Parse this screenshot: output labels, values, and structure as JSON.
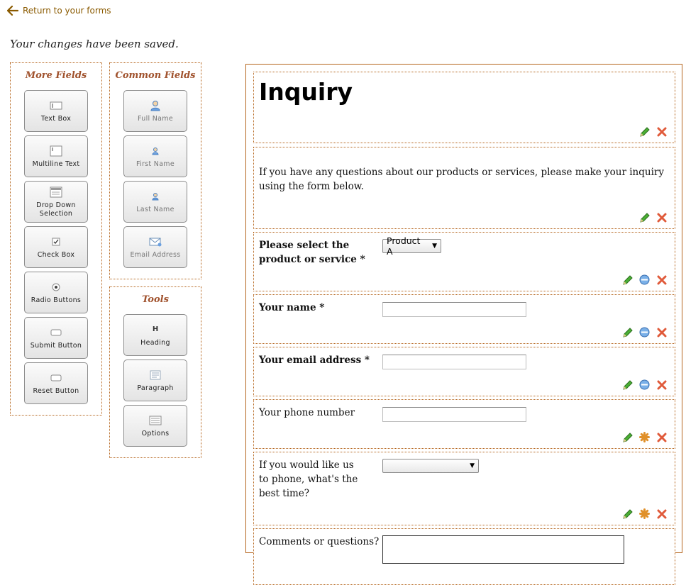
{
  "nav": {
    "return_label": "Return to your forms"
  },
  "status": {
    "saved_message": "Your changes have been saved."
  },
  "more_fields": {
    "title": "More Fields",
    "items": [
      {
        "label": "Text Box",
        "icon": "text-box-icon"
      },
      {
        "label": "Multiline Text",
        "icon": "multiline-text-icon"
      },
      {
        "label": "Drop Down Selection",
        "icon": "dropdown-icon"
      },
      {
        "label": "Check Box",
        "icon": "checkbox-icon"
      },
      {
        "label": "Radio Buttons",
        "icon": "radio-icon"
      },
      {
        "label": "Submit Button",
        "icon": "button-icon"
      },
      {
        "label": "Reset Button",
        "icon": "button-icon"
      }
    ]
  },
  "common_fields": {
    "title": "Common Fields",
    "items": [
      {
        "label": "Full Name",
        "icon": "person-icon"
      },
      {
        "label": "First Name",
        "icon": "person-icon"
      },
      {
        "label": "Last Name",
        "icon": "person-icon"
      },
      {
        "label": "Email Address",
        "icon": "email-icon"
      }
    ]
  },
  "tools": {
    "title": "Tools",
    "items": [
      {
        "label": "Heading",
        "icon": "heading-icon"
      },
      {
        "label": "Paragraph",
        "icon": "paragraph-icon"
      },
      {
        "label": "Options",
        "icon": "options-icon"
      }
    ]
  },
  "form": {
    "heading": "Inquiry",
    "paragraph": "If you have any questions about our products or services, please make your inquiry using the form below.",
    "fields": [
      {
        "label": "Please select the product or service *",
        "type": "select",
        "value": "Product A",
        "required": true
      },
      {
        "label": "Your name *",
        "type": "text",
        "value": "",
        "required": true
      },
      {
        "label": "Your email address *",
        "type": "text",
        "value": "",
        "required": true
      },
      {
        "label": "Your phone number",
        "type": "text",
        "value": "",
        "required": false
      },
      {
        "label": "If you would like us to phone, what's the best time?",
        "type": "select",
        "value": "",
        "required": false
      },
      {
        "label": "Comments or questions?",
        "type": "textarea",
        "value": "",
        "required": false
      }
    ]
  },
  "colors": {
    "accent": "#b5651d",
    "panel_title": "#a0522d",
    "edit_green": "#3a9a2a",
    "delete_red": "#e05a3a",
    "required_blue": "#5b8fd0",
    "optional_orange": "#e0902a"
  }
}
